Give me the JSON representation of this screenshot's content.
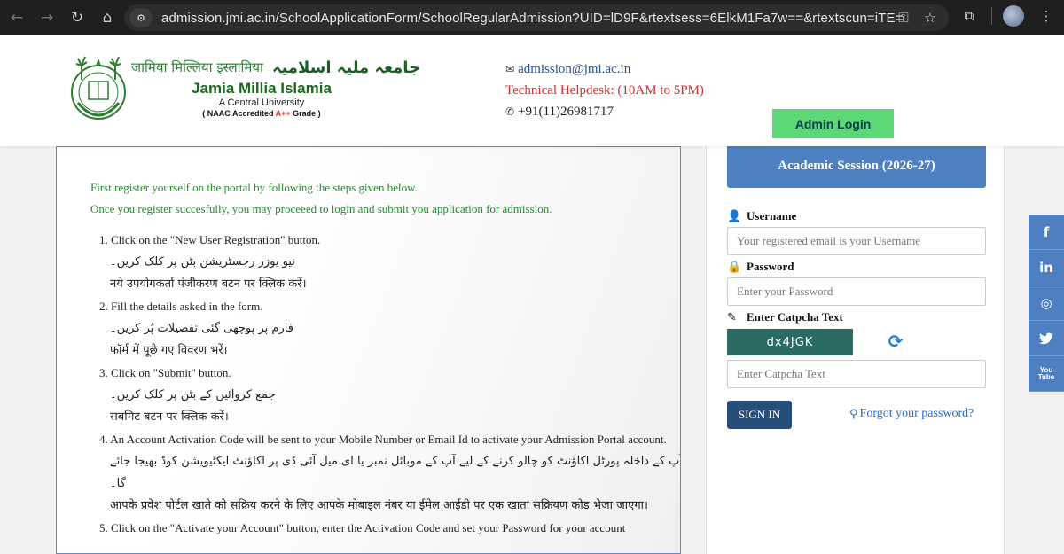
{
  "browser": {
    "back_icon": "←",
    "forward_icon": "→",
    "reload_icon": "↻",
    "home_icon": "⌂",
    "url": "admission.jmi.ac.in/SchoolApplicationForm/SchoolRegularAdmission?UID=lD9F&rtextsess=6ElkM1Fa7w==&rtextscun=iTE=",
    "key_icon": "⚿",
    "star_icon": "☆",
    "ext_icon": "⧉",
    "menu_icon": "⋮"
  },
  "header": {
    "hindi_name": "जामिया मिल्लिया इस्लामिया",
    "urdu_name": "جامعہ ملیہ اسلامیہ",
    "name": "Jamia Millia Islamia",
    "subtitle": "A Central University",
    "naac_prefix": "( NAAC Accredited ",
    "naac_grade": "A++",
    "naac_suffix": " Grade )",
    "email": "admission@jmi.ac.in",
    "helpdesk": "Technical Helpdesk: (10AM to 5PM)",
    "phone": "+91(11)26981717",
    "admin_login": "Admin Login"
  },
  "instructions": {
    "intro_1": "First register yourself on the portal by following the steps given below.",
    "intro_2": "Once you register succesfully, you may proceeed to login and submit you application for admission.",
    "steps": [
      {
        "en": "1. Click on the \"New User Registration\" button.",
        "ur": "نیو یوزر رجسٹریشن بٹن پر کلک کریں۔",
        "hi": "नये उपयोगकर्ता पंजीकरण बटन पर क्लिक करें।"
      },
      {
        "en": "2. Fill the details asked in the form.",
        "ur": "فارم پر پوچھی گئی تفصیلات پُر کریں۔",
        "hi": "फॉर्म में पूछे गए विवरण भरें।"
      },
      {
        "en": "3. Click on \"Submit\" button.",
        "ur": "جمع کروائیں کے بٹن پر کلک کریں۔",
        "hi": "सबमिट बटन पर क्लिक करें।"
      },
      {
        "en": "4. An Account Activation Code will be sent to your Mobile Number or Email Id to activate your Admission Portal account.",
        "ur": "آپ کے داخلہ پورٹل اکاؤنٹ کو چالو کرنے کے لیے آپ کے موبائل نمبر یا ای میل آئی ڈی پر اکاؤنٹ ایکٹیویشن کوڈ بھیجا جائے گا۔",
        "hi": "आपके प्रवेश पोर्टल खाते को सक्रिय करने के लिए आपके मोबाइल नंबर या ईमेल आईडी पर एक खाता सक्रियण कोड भेजा जाएगा।"
      },
      {
        "en": "5. Click on the \"Activate your Account\" button, enter the Activation Code and set your Password for your account",
        "ur": "",
        "hi": ""
      }
    ]
  },
  "login": {
    "session": "Academic Session (2026-27)",
    "username_label": "Username",
    "username_placeholder": "Your registered email is your Username",
    "password_label": "Password",
    "password_placeholder": "Enter your Password",
    "captcha_label": "Enter Catpcha Text",
    "captcha_code": "dx4JGK",
    "captcha_placeholder": "Enter Catpcha Text",
    "signin": "SIGN IN",
    "forgot": "Forgot your password?"
  },
  "social": {
    "facebook": "f",
    "linkedin": "in",
    "instagram": "◎",
    "twitter": "🐦",
    "youtube_1": "You",
    "youtube_2": "Tube"
  }
}
